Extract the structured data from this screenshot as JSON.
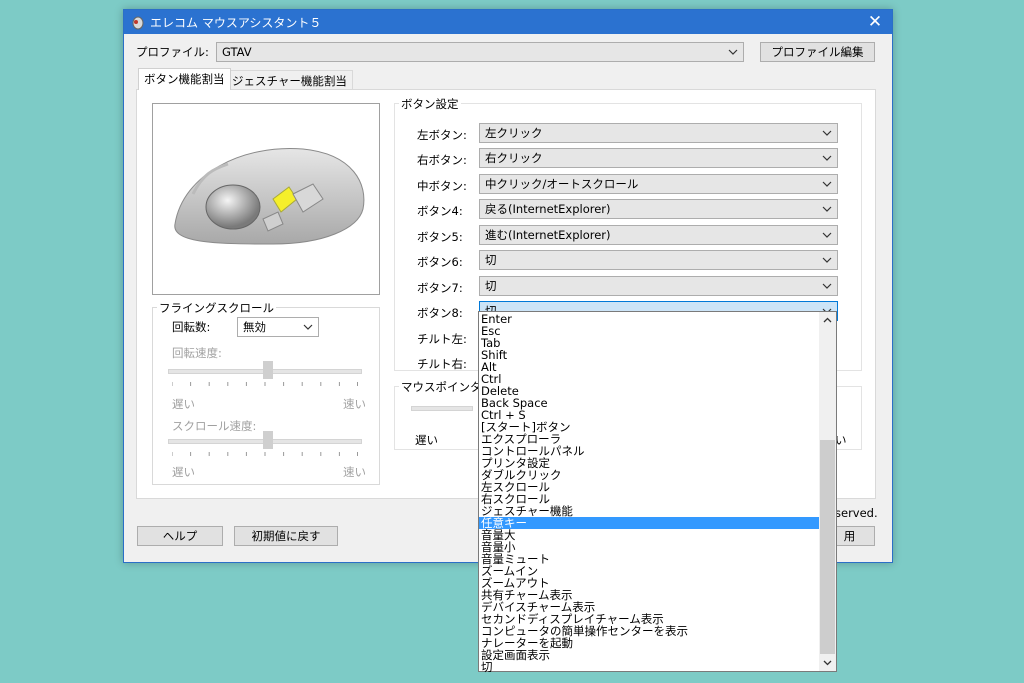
{
  "window": {
    "title": "エレコム マウスアシスタント５",
    "close_glyph": "✕"
  },
  "profile": {
    "label": "プロファイル:",
    "value": "GTAV",
    "edit_button": "プロファイル編集"
  },
  "tabs": [
    {
      "label": "ボタン機能割当"
    },
    {
      "label": "ジェスチャー機能割当"
    }
  ],
  "button_settings": {
    "group_title": "ボタン設定",
    "rows": [
      {
        "label": "左ボタン:",
        "value": "左クリック"
      },
      {
        "label": "右ボタン:",
        "value": "右クリック"
      },
      {
        "label": "中ボタン:",
        "value": "中クリック/オートスクロール"
      },
      {
        "label": "ボタン4:",
        "value": "戻る(InternetExplorer)"
      },
      {
        "label": "ボタン5:",
        "value": "進む(InternetExplorer)"
      },
      {
        "label": "ボタン6:",
        "value": "切"
      },
      {
        "label": "ボタン7:",
        "value": "切"
      },
      {
        "label": "ボタン8:",
        "value": "切"
      }
    ],
    "tilt_left_label": "チルト左:",
    "tilt_right_label": "チルト右:"
  },
  "flying_scroll": {
    "group_title": "フライングスクロール",
    "rotation_label": "回転数:",
    "rotation_value": "無効",
    "rotation_speed_label": "回転速度:",
    "scroll_speed_label": "スクロール速度:",
    "slow": "遅い",
    "fast": "速い",
    "rotation_speed_level": 0.45,
    "scroll_speed_level": 0.45
  },
  "pointer": {
    "group_title_partial": "マウスポインタの",
    "slow": "遅い",
    "fast_partial": "い"
  },
  "footer": {
    "help_button": "ヘルプ",
    "reset_button": "初期値に戻す",
    "copyright_partial": "served.",
    "apply_partial": "用"
  },
  "dropdown": {
    "options": [
      "Enter",
      "Esc",
      "Tab",
      "Shift",
      "Alt",
      "Ctrl",
      "Delete",
      "Back Space",
      "Ctrl + S",
      "[スタート]ボタン",
      "エクスプローラ",
      "コントロールパネル",
      "プリンタ設定",
      "ダブルクリック",
      "左スクロール",
      "右スクロール",
      "ジェスチャー機能",
      "任意キー",
      "音量大",
      "音量小",
      "音量ミュート",
      "ズームイン",
      "ズームアウト",
      "共有チャーム表示",
      "デバイスチャーム表示",
      "セカンドディスプレイチャーム表示",
      "コンピュータの簡単操作センターを表示",
      "ナレーターを起動",
      "設定画面表示",
      "切"
    ],
    "selected_index": 17
  },
  "colors": {
    "titlebar": "#2b72d0",
    "selection": "#3399ff",
    "background": "#7dcbc6"
  }
}
